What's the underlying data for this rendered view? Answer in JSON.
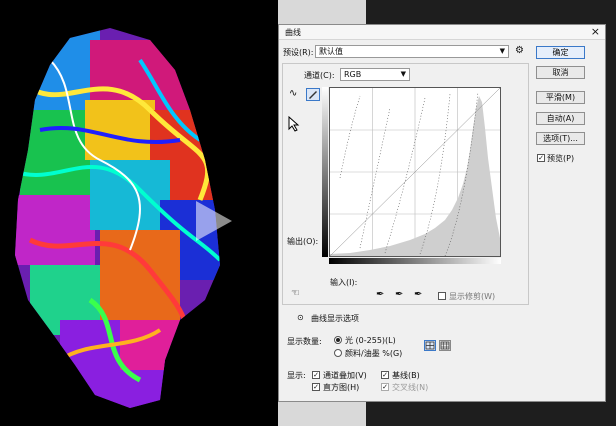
{
  "dialog": {
    "title": "曲线",
    "close": "×",
    "preset_label": "预设(R):",
    "preset_value": "默认值",
    "preset_gear": "⚙",
    "channel_label": "通道(C):",
    "channel_value": "RGB",
    "output_label": "输出(O):",
    "input_label": "输入(I):",
    "show_clipping": "显示修剪(W)",
    "curve_display_options": "曲线显示选项",
    "show_amount_label": "显示数量:",
    "light_option": "光 (0-255)(L)",
    "pigment_option": "颜料/油墨 %(G)",
    "show_label": "显示:",
    "channel_overlays": "通道叠加(V)",
    "baseline": "基线(B)",
    "histogram": "直方图(H)",
    "intersection_line": "交叉线(N)",
    "buttons": {
      "ok": "确定",
      "cancel": "取消",
      "smooth": "平滑(M)",
      "auto": "自动(A)",
      "options": "选项(T)...",
      "preview": "预览(P)"
    }
  },
  "colors": {
    "accent": "#3a78c8",
    "panel": "#f0f0f0"
  }
}
